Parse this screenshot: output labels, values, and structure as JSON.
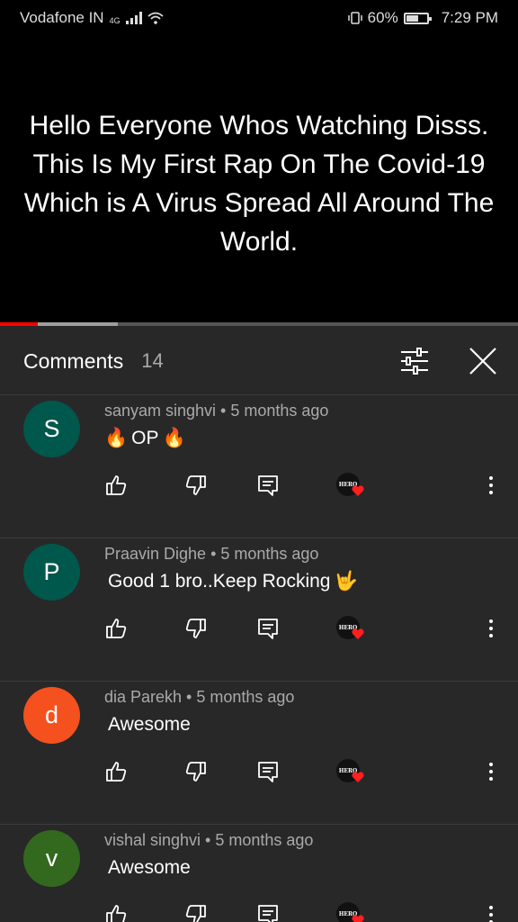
{
  "status_bar": {
    "carrier": "Vodafone IN",
    "network": "4G",
    "battery": "60%",
    "time": "7:29 PM"
  },
  "video": {
    "caption": "Hello Everyone Whos Watching Disss. This Is My First Rap On The Covid-19 Which is A Virus Spread All Around The World.",
    "progress_played_fraction": 0.073,
    "progress_buffered_fraction": 0.227
  },
  "comments_panel": {
    "title": "Comments",
    "count": "14",
    "filter_icon": "sort-filter-icon",
    "close_icon": "close-icon"
  },
  "creator_badge": {
    "text": "HERO"
  },
  "comments": [
    {
      "avatar_letter": "S",
      "avatar_color": "#00574b",
      "meta": "sanyam singhvi • 5 months ago",
      "emoji_before": "🔥",
      "text": "OP",
      "emoji_after": "🔥"
    },
    {
      "avatar_letter": "P",
      "avatar_color": "#00574b",
      "meta": "Praavin Dighe • 5 months ago",
      "emoji_before": "",
      "text": "Good 1 bro..Keep Rocking",
      "emoji_after": "🤟"
    },
    {
      "avatar_letter": "d",
      "avatar_color": "#f4511e",
      "meta": "dia Parekh • 5 months ago",
      "emoji_before": "",
      "text": "Awesome",
      "emoji_after": ""
    },
    {
      "avatar_letter": "v",
      "avatar_color": "#33691e",
      "meta": "vishal singhvi • 5 months ago",
      "emoji_before": "",
      "text": "Awesome",
      "emoji_after": ""
    }
  ]
}
